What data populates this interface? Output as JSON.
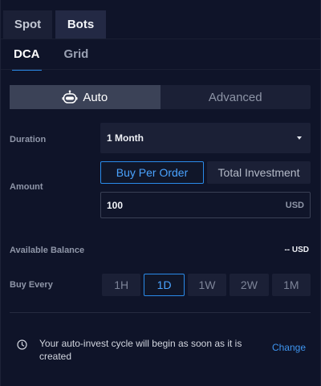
{
  "top_tabs": [
    {
      "label": "Spot",
      "active": false
    },
    {
      "label": "Bots",
      "active": true
    }
  ],
  "sub_tabs": [
    {
      "label": "DCA",
      "active": true
    },
    {
      "label": "Grid",
      "active": false
    }
  ],
  "mode": {
    "auto_label": "Auto",
    "advanced_label": "Advanced",
    "selected": "Auto",
    "auto_icon": "robot-icon"
  },
  "duration": {
    "label": "Duration",
    "value": "1 Month"
  },
  "amount": {
    "label": "Amount",
    "buy_per_order_label": "Buy Per Order",
    "total_investment_label": "Total Investment",
    "selected": "Buy Per Order",
    "value": "100",
    "unit": "USD"
  },
  "balance": {
    "label": "Available Balance",
    "value": "-- USD"
  },
  "buy_every": {
    "label": "Buy Every",
    "options": [
      "1H",
      "1D",
      "1W",
      "2W",
      "1M"
    ],
    "selected": "1D"
  },
  "notice": {
    "text": "Your auto-invest cycle will begin as soon as it is created",
    "action_label": "Change",
    "icon": "clock-icon"
  },
  "colors": {
    "accent": "#2a8bea",
    "background": "#0f1429",
    "surface": "#1b2036"
  }
}
